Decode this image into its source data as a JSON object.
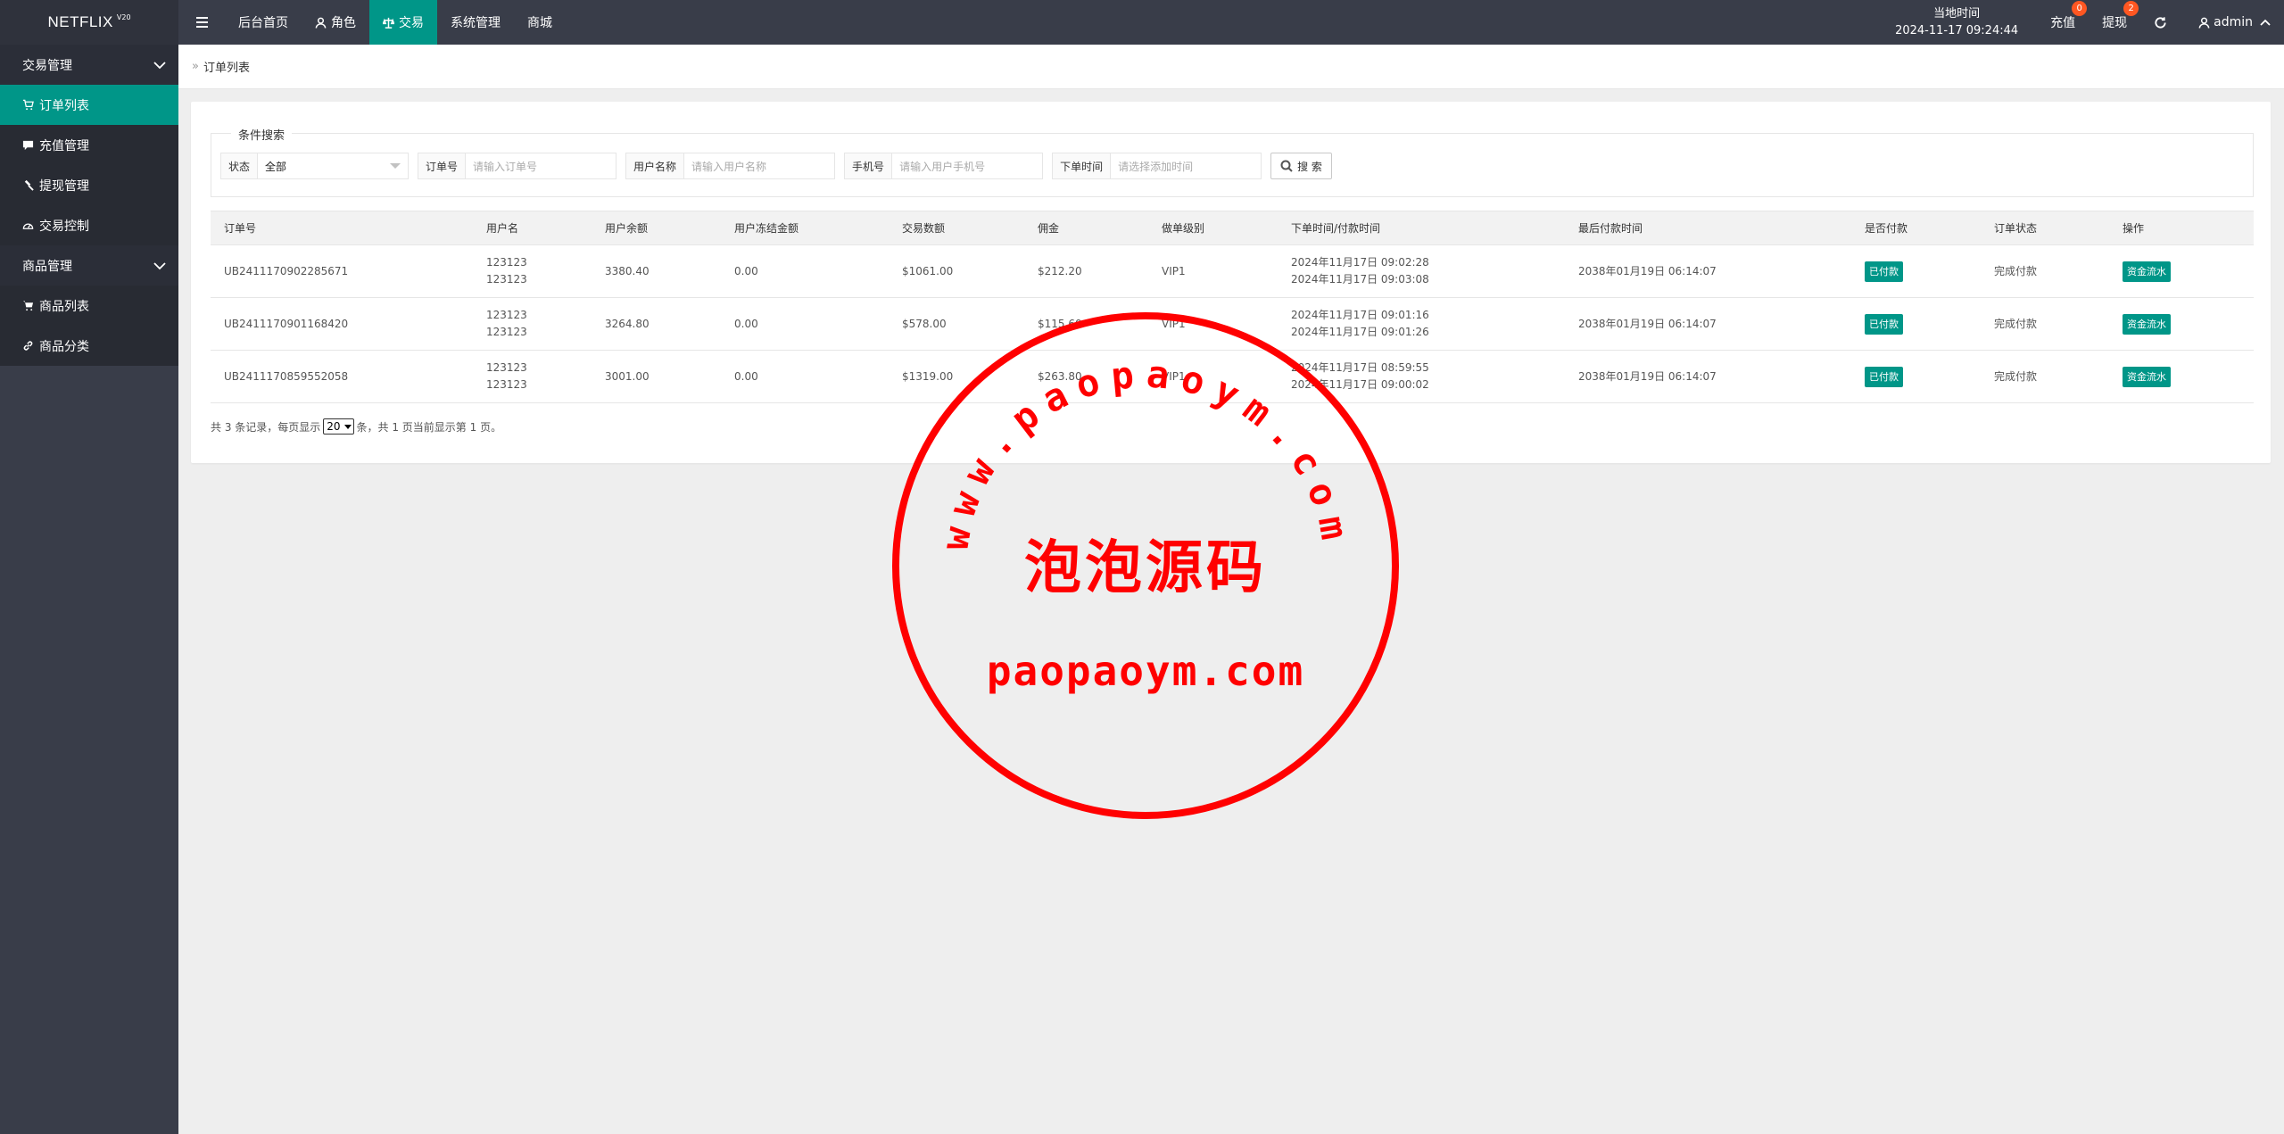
{
  "brand": {
    "name": "NETFLIX",
    "version": "V20"
  },
  "top_nav": [
    {
      "label": "后台首页",
      "icon": "",
      "active": false
    },
    {
      "label": "角色",
      "icon": "user-icon",
      "active": false
    },
    {
      "label": "交易",
      "icon": "balance-icon",
      "active": true
    },
    {
      "label": "系统管理",
      "icon": "",
      "active": false
    },
    {
      "label": "商城",
      "icon": "",
      "active": false
    }
  ],
  "header_right": {
    "time_label": "当地时间",
    "time_value": "2024-11-17 09:24:44",
    "recharge": {
      "label": "充值",
      "badge": "0"
    },
    "withdraw": {
      "label": "提现",
      "badge": "2"
    },
    "user": "admin"
  },
  "sidebar": {
    "groups": [
      {
        "title": "交易管理",
        "items": [
          {
            "label": "订单列表",
            "icon": "cart-icon",
            "active": true
          },
          {
            "label": "充值管理",
            "icon": "chat-icon",
            "active": false
          },
          {
            "label": "提现管理",
            "icon": "hammer-icon",
            "active": false
          },
          {
            "label": "交易控制",
            "icon": "dashboard-icon",
            "active": false
          }
        ]
      },
      {
        "title": "商品管理",
        "items": [
          {
            "label": "商品列表",
            "icon": "cart-icon",
            "active": false
          },
          {
            "label": "商品分类",
            "icon": "link-icon",
            "active": false
          }
        ]
      }
    ]
  },
  "breadcrumb": {
    "current": "订单列表"
  },
  "search": {
    "legend": "条件搜索",
    "status": {
      "label": "状态",
      "value": "全部"
    },
    "order_no": {
      "label": "订单号",
      "placeholder": "请输入订单号"
    },
    "username": {
      "label": "用户名称",
      "placeholder": "请输入用户名称"
    },
    "phone": {
      "label": "手机号",
      "placeholder": "请输入用户手机号"
    },
    "order_time": {
      "label": "下单时间",
      "placeholder": "请选择添加时间"
    },
    "button": "搜 索"
  },
  "table": {
    "headers": [
      "订单号",
      "用户名",
      "用户余额",
      "用户冻结金额",
      "交易数额",
      "佣金",
      "做单级别",
      "下单时间/付款时间",
      "最后付款时间",
      "是否付款",
      "订单状态",
      "操作"
    ],
    "rows": [
      {
        "order_no": "UB2411170902285671",
        "user1": "123123",
        "user2": "123123",
        "balance": "3380.40",
        "frozen": "0.00",
        "amount": "$1061.00",
        "commission": "$212.20",
        "level": "VIP1",
        "time1": "2024年11月17日 09:02:28",
        "time2": "2024年11月17日 09:03:08",
        "last_pay": "2038年01月19日 06:14:07",
        "paid": "已付款",
        "status": "完成付款",
        "action": "资金流水"
      },
      {
        "order_no": "UB2411170901168420",
        "user1": "123123",
        "user2": "123123",
        "balance": "3264.80",
        "frozen": "0.00",
        "amount": "$578.00",
        "commission": "$115.60",
        "level": "VIP1",
        "time1": "2024年11月17日 09:01:16",
        "time2": "2024年11月17日 09:01:26",
        "last_pay": "2038年01月19日 06:14:07",
        "paid": "已付款",
        "status": "完成付款",
        "action": "资金流水"
      },
      {
        "order_no": "UB2411170859552058",
        "user1": "123123",
        "user2": "123123",
        "balance": "3001.00",
        "frozen": "0.00",
        "amount": "$1319.00",
        "commission": "$263.80",
        "level": "VIP1",
        "time1": "2024年11月17日 08:59:55",
        "time2": "2024年11月17日 09:00:02",
        "last_pay": "2038年01月19日 06:14:07",
        "paid": "已付款",
        "status": "完成付款",
        "action": "资金流水"
      }
    ]
  },
  "pager": {
    "prefix": "共 3 条记录，每页显示",
    "page_size": "20",
    "suffix": "条，共 1 页当前显示第 1 页。"
  },
  "watermark": {
    "arc_text": "www.paopaoym.com",
    "center_text": "泡泡源码",
    "bottom_text": "paopaoym.com",
    "color": "#ff0000"
  },
  "colors": {
    "accent": "#009688",
    "header": "#393d49",
    "badge": "#ff5722"
  }
}
